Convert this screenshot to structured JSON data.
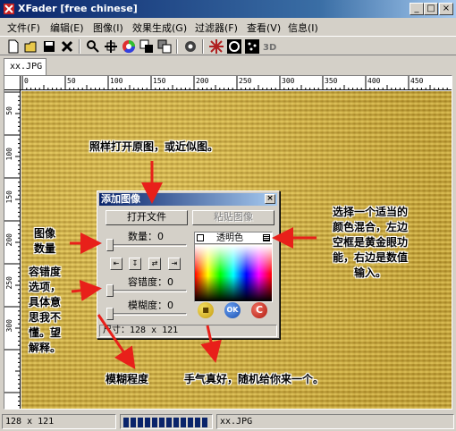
{
  "window": {
    "title": "XFader [free chinese]",
    "min": "_",
    "max": "□",
    "close": "×"
  },
  "menu": [
    "文件(F)",
    "编辑(E)",
    "图像(I)",
    "效果生成(G)",
    "过滤器(F)",
    "查看(V)",
    "信息(I)"
  ],
  "toolbar": {
    "icons": [
      "new-icon",
      "open-icon",
      "save-icon",
      "close-x-icon",
      "magnify-icon",
      "crosshair-icon",
      "color-wheel-icon",
      "layers-icon",
      "stack-icon",
      "gear-icon",
      "star-icon",
      "swirl-icon",
      "dots-icon",
      "3d-icon"
    ]
  },
  "tab": {
    "label": "xx.JPG"
  },
  "ruler": {
    "h_labels": [
      "0",
      "50",
      "100",
      "150",
      "200",
      "250",
      "300",
      "350",
      "400",
      "450"
    ],
    "v_labels": [
      "50",
      "100",
      "150",
      "200",
      "250",
      "300"
    ]
  },
  "annotations": {
    "top": "照样打开原图，或近似图。",
    "left_num": [
      "图像",
      "数量"
    ],
    "tolerance": [
      "容错度",
      "选项，",
      "具体意",
      "思我不",
      "懂。望",
      "解释。"
    ],
    "blur": "模糊程度",
    "right": [
      "选择一个适当的",
      "颜色混合，左边",
      "空框是黄金眼功",
      "能，右边是数值",
      "输入。"
    ],
    "luck": "手气真好，随机给你来一个。"
  },
  "dialog": {
    "title": "添加图像",
    "close": "×",
    "open_file": "打开文件",
    "paste_image": "粘贴图像",
    "count_label": "数量：0",
    "transparent": "透明色",
    "tolerance_label": "容错度：0",
    "blur_label": "模糊度：0",
    "ok": "OK",
    "cancel": "C",
    "size": "尺寸：128 x 121",
    "progress": {
      "count": 0
    }
  },
  "statusbar": {
    "size": "128 x 121",
    "progress_blocks": 12,
    "filename": "xx.JPG"
  },
  "colors": {
    "accent": "#0a246a",
    "arrow": "#e8201a",
    "canvas": "#c9a83d"
  }
}
